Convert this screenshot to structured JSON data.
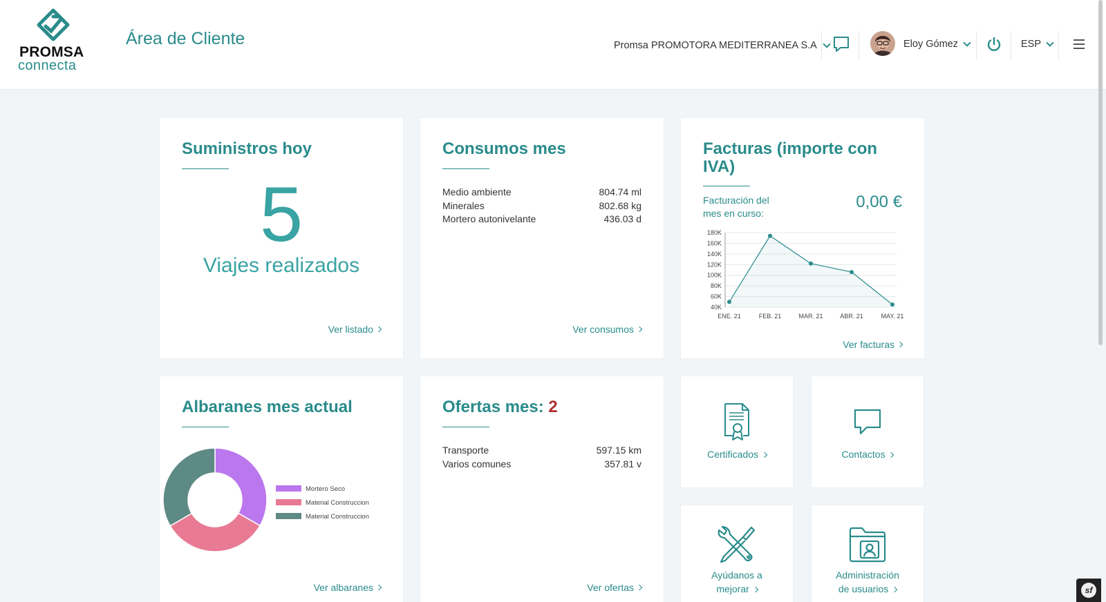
{
  "header": {
    "logo_word_top": "PROMSA",
    "logo_word_bottom": "connecta",
    "page_title": "Área de Cliente",
    "company": "Promsa PROMOTORA MEDITERRANEA S.A",
    "chat_icon": "chat-bubble-icon",
    "user_name": "Eloy Gómez",
    "power_icon": "power-icon",
    "language": "ESP",
    "menu_icon": "hamburger-menu-icon"
  },
  "colors": {
    "accent": "#2a8b8b",
    "accent_light": "#3aa3a3",
    "offer_count": "#b03030",
    "background": "#f2f5f7"
  },
  "suministros": {
    "title": "Suministros hoy",
    "count": "5",
    "subtitle": "Viajes realizados",
    "link": "Ver listado"
  },
  "consumos": {
    "title": "Consumos mes",
    "rows": [
      {
        "label": "Medio ambiente",
        "value": "804.74 ml"
      },
      {
        "label": "Minerales",
        "value": "802.68 kg"
      },
      {
        "label": "Mortero autonivelante",
        "value": "436.03 d"
      }
    ],
    "link": "Ver consumos"
  },
  "facturas": {
    "title": "Facturas (importe con IVA)",
    "label": "Facturación del mes en curso:",
    "amount": "0,00 €",
    "link": "Ver facturas"
  },
  "chart_data": [
    {
      "type": "area",
      "categories": [
        "ENE. 21",
        "FEB. 21",
        "MAR. 21",
        "ABR. 21",
        "MAY. 21"
      ],
      "values": [
        50000,
        174000,
        122000,
        106000,
        45000
      ],
      "yticks": [
        "40K",
        "60K",
        "80K",
        "100K",
        "120K",
        "140K",
        "160K",
        "180K"
      ],
      "ylim": [
        40000,
        180000
      ],
      "grid": true,
      "color": "#2a8b8b"
    },
    {
      "type": "pie",
      "legend_position": "right",
      "series": [
        {
          "name": "Mortero Seco",
          "value": 33.3,
          "color": "#bb77ee"
        },
        {
          "name": "Material Construccion",
          "value": 33.3,
          "color": "#e87a93"
        },
        {
          "name": "Material Construccion",
          "value": 33.4,
          "color": "#5e8a85"
        }
      ]
    }
  ],
  "albaranes": {
    "title": "Albaranes mes actual",
    "link": "Ver albaranes"
  },
  "ofertas": {
    "title": "Ofertas mes:",
    "count": "2",
    "rows": [
      {
        "label": "Transporte",
        "value": "597.15 km"
      },
      {
        "label": "Varios comunes",
        "value": "357.81 v"
      }
    ],
    "link": "Ver ofertas"
  },
  "tiles": [
    {
      "label": "Certificados",
      "icon": "certificate-icon"
    },
    {
      "label": "Contactos",
      "icon": "chat-bubble-icon"
    },
    {
      "label_line1": "Ayúdanos a",
      "label_line2": "mejorar",
      "icon": "tools-icon"
    },
    {
      "label_line1": "Administración",
      "label_line2": "de usuarios",
      "icon": "user-folder-icon"
    }
  ],
  "debug_toolbar": {
    "label": "sf",
    "icon": "symfony-icon"
  }
}
